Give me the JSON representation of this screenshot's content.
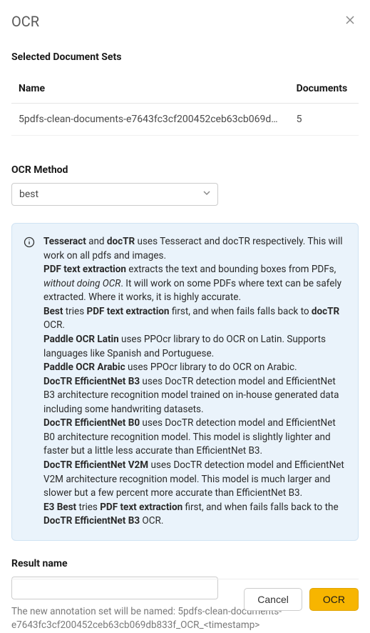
{
  "header": {
    "title": "OCR"
  },
  "selected_sets": {
    "title": "Selected Document Sets",
    "columns": [
      "Name",
      "Documents"
    ],
    "rows": [
      {
        "name": "5pdfs-clean-documents-e7643fc3cf200452ceb63cb069db83...",
        "documents": "5"
      }
    ]
  },
  "method": {
    "label": "OCR Method",
    "value": "best"
  },
  "info": {
    "p1_pre": "Tesseract",
    "p1_mid1": " and ",
    "p1_b2": "docTR",
    "p1_tail": " uses Tesseract and docTR respectively. This will work on all pdfs and images.",
    "p2_b": "PDF text extraction",
    "p2_mid": " extracts the text and bounding boxes from PDFs, ",
    "p2_i": "without doing OCR",
    "p2_tail": ". It will work on some PDFs where text can be safely extracted. Where it works, it is highly accurate.",
    "p3_b1": "Best",
    "p3_mid1": " tries ",
    "p3_b2": "PDF text extraction",
    "p3_mid2": " first, and when fails falls back to ",
    "p3_b3": "docTR",
    "p3_tail": " OCR.",
    "p4_b": "Paddle OCR Latin",
    "p4_tail": " uses PPOcr library to do OCR on Latin. Supports languages like Spanish and Portuguese.",
    "p5_b": "Paddle OCR Arabic",
    "p5_tail": " uses PPOcr library to do OCR on Arabic.",
    "p6_b": "DocTR EfficientNet B3",
    "p6_tail": " uses DocTR detection model and EfficientNet B3 architecture recognition model trained on in-house generated data including some handwriting datasets.",
    "p7_b": "DocTR EfficientNet B0",
    "p7_tail": " uses DocTR detection model and EfficientNet B0 architecture recognition model. This model is slightly lighter and faster but a little less accurate than EfficientNet B3.",
    "p8_b": "DocTR EfficientNet V2M",
    "p8_tail": " uses DocTR detection model and EfficientNet V2M architecture recognition model. This model is much larger and slower but a few percent more accurate than EfficientNet B3.",
    "p9_b1": "E3 Best",
    "p9_mid1": " tries ",
    "p9_b2": "PDF text extraction",
    "p9_mid2": " first, and when fails falls back to the ",
    "p9_b3": "DocTR EfficientNet B3",
    "p9_tail": " OCR."
  },
  "result": {
    "label": "Result name",
    "value": "",
    "help": "The new annotation set will be named: 5pdfs-clean-documents-e7643fc3cf200452ceb63cb069db833f_OCR_<timestamp>"
  },
  "footer": {
    "cancel": "Cancel",
    "submit": "OCR"
  }
}
